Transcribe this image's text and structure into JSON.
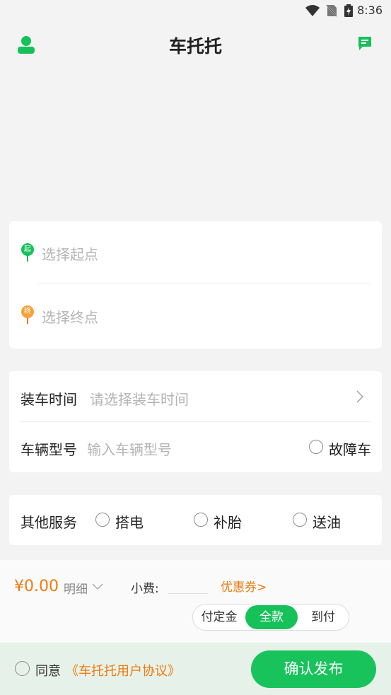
{
  "status_bar": {
    "time": "8:36"
  },
  "header": {
    "title": "车托托",
    "profile_icon": "user-icon",
    "message_icon": "message-icon"
  },
  "route": {
    "start_marker": "起",
    "start_placeholder": "选择起点",
    "end_marker": "终",
    "end_placeholder": "选择终点"
  },
  "details": {
    "load_time_label": "装车时间",
    "load_time_placeholder": "请选择装车时间",
    "vehicle_label": "车辆型号",
    "vehicle_placeholder": "输入车辆型号",
    "broken_label": "故障车"
  },
  "services": {
    "label": "其他服务",
    "options": [
      "搭电",
      "补胎",
      "送油"
    ]
  },
  "pricing": {
    "price": "¥0.00",
    "detail_label": "明细",
    "tip_label": "小费:",
    "coupon_label": "优惠券>",
    "payment_options": [
      "付定金",
      "全款",
      "到付"
    ],
    "selected_payment": "全款"
  },
  "footer": {
    "agree_label": "同意",
    "agreement_link": "《车托托用户协议》",
    "submit_label": "确认发布"
  },
  "colors": {
    "accent": "#16c15a",
    "orange": "#f07a10",
    "background": "#f3f3f3"
  }
}
